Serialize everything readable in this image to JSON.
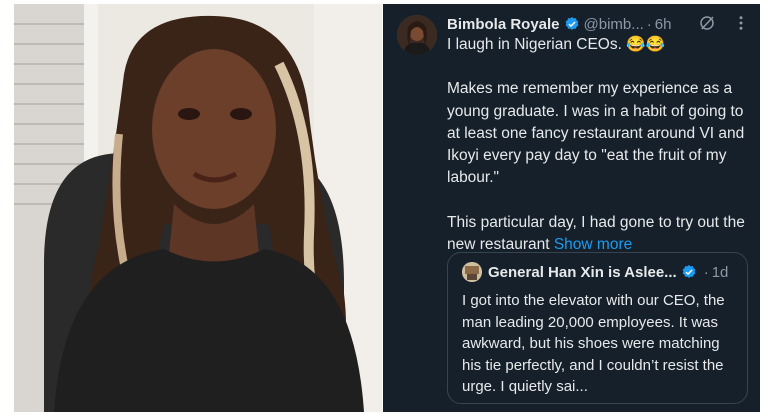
{
  "tweet": {
    "author_name": "Bimbola Royale",
    "handle": "@bimb...",
    "separator": "·",
    "time": "6h",
    "icons": [
      "verified-badge-icon",
      "grok-icon",
      "more-icon"
    ],
    "line1": "I laugh in Nigerian CEOs. 😂😂",
    "para2": "Makes me remember my experience as a young graduate. I was in a habit of going to at least one fancy restaurant around VI and Ikoyi every pay day to \"eat the fruit of my labour.\"",
    "para3": "This particular day, I had gone to try out the new restaurant",
    "show_more": "Show more"
  },
  "quote": {
    "author_name": "General Han Xin is Aslee...",
    "separator": "·",
    "time": "1d",
    "text": "I got into the elevator with our CEO, the man leading 20,000 employees. It was awkward, but his shoes were matching his tie perfectly, and I couldn’t resist the urge. I quietly sai..."
  },
  "colors": {
    "background": "#15202b",
    "text": "#e7e9ea",
    "secondary": "#8b98a5",
    "link": "#1d9bf0",
    "verified": "#1d9bf0",
    "border": "#38444d"
  }
}
